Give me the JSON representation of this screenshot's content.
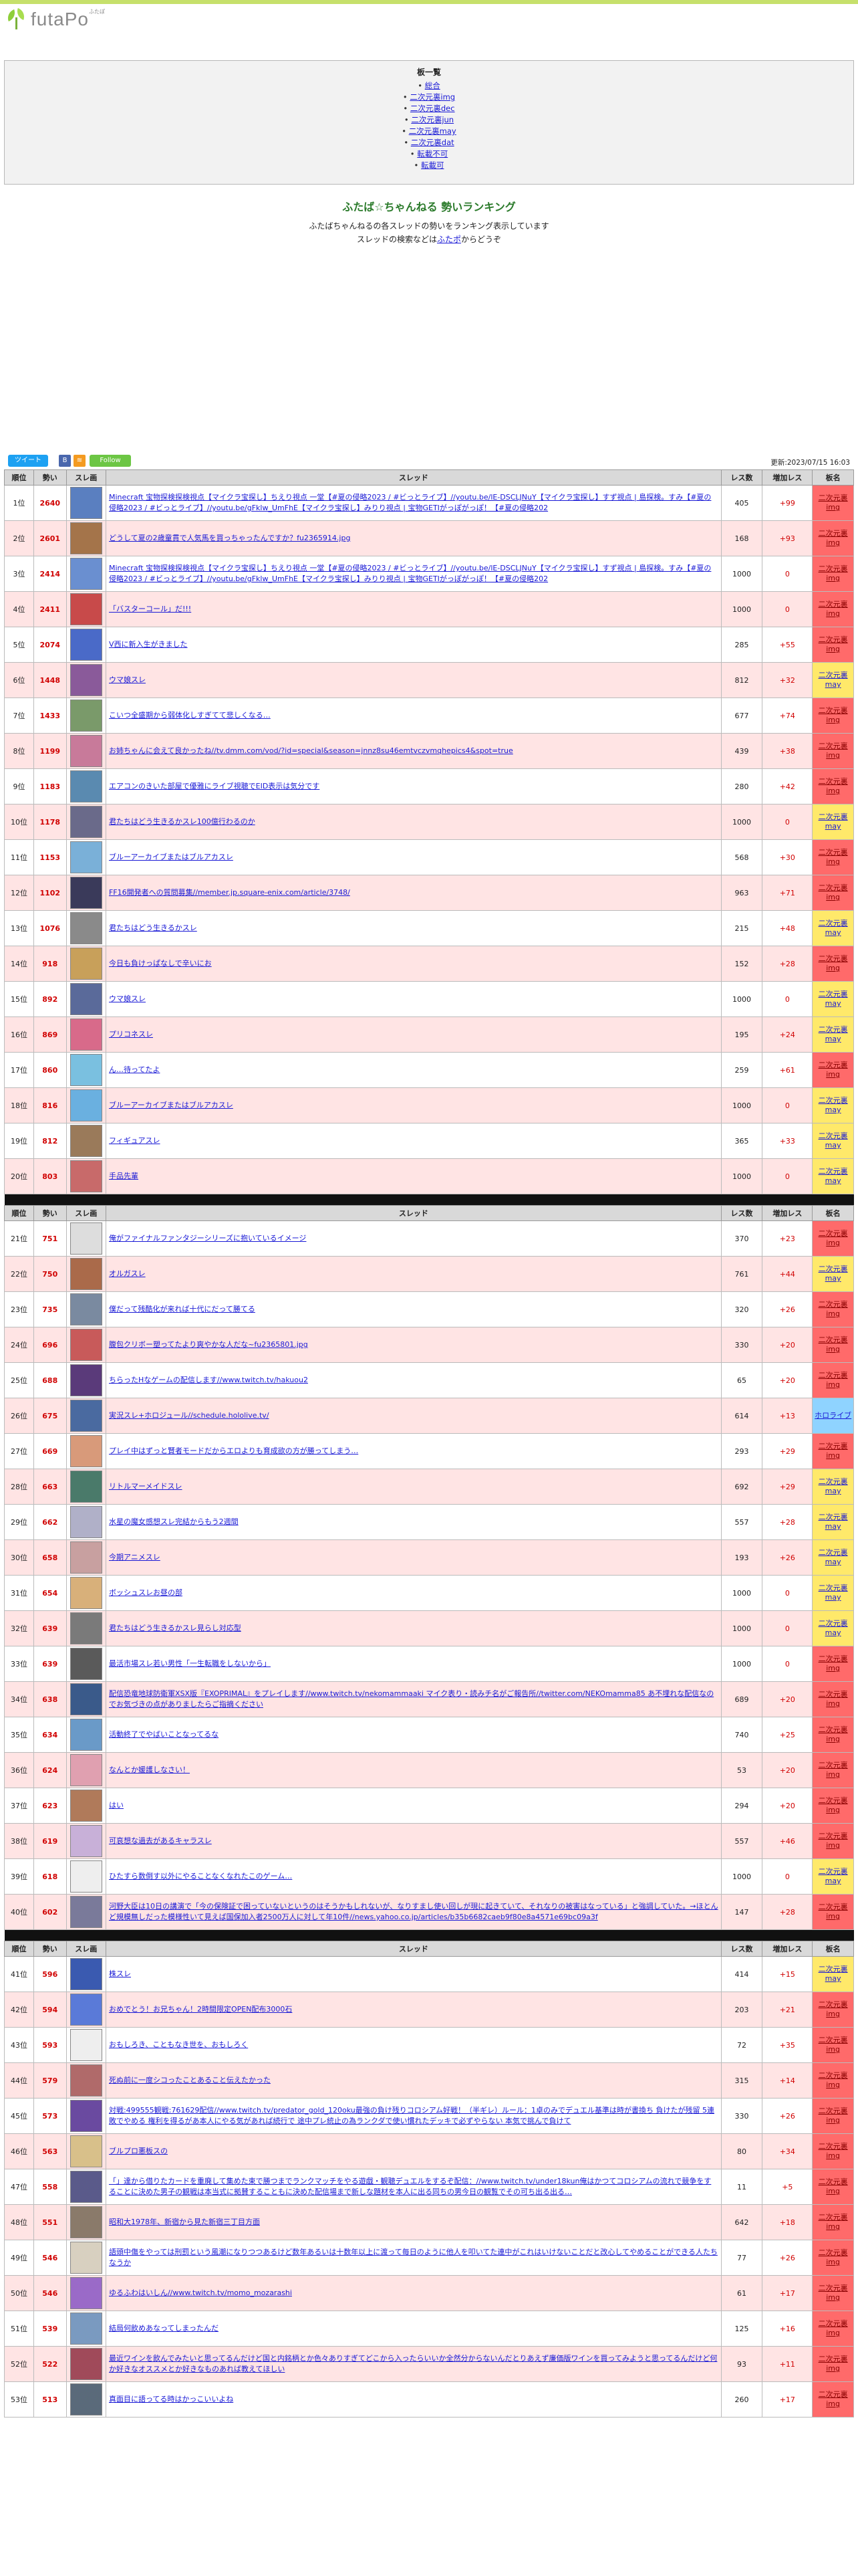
{
  "site": {
    "logo_text": "futaPo",
    "logo_sup": "ふたぽ"
  },
  "menu": {
    "title": "板一覧",
    "items": [
      "総合",
      "二次元裏img",
      "二次元裏dec",
      "二次元裏jun",
      "二次元裏may",
      "二次元裏dat",
      "転載不可",
      "転載可"
    ]
  },
  "intro": {
    "title": "ふたば☆ちゃんねる 勢いランキング",
    "line1": "ふたばちゃんねるの各スレッドの勢いをランキング表示しています",
    "line2_pre": "スレッドの検索などは",
    "line2_link": "ふたポ",
    "line2_post": "からどうぞ"
  },
  "share": {
    "tweet": "ツイート",
    "follow": "Follow",
    "updated": "更新:2023/07/15 16:03"
  },
  "table_headers": [
    "順位",
    "勢い",
    "スレ画",
    "スレッド",
    "レス数",
    "増加レス",
    "板名"
  ],
  "colors": {
    "img": "#ff6a6a",
    "may": "#ffe96a",
    "holo": "#8fd3ff",
    "row_alt": "#ffe4e4",
    "accent": "#d00000"
  },
  "rows": [
    {
      "rank": "1位",
      "ikioi": "2640",
      "title": "Minecraft 宝物探検探検視点【マイクラ宝探し】ちえり視点 一堂【#夏の侵略2023 / #ビっとライブ】//youtu.be/lE-DSCLJNuY【マイクラ宝探し】すず視点 | 島探検。すみ【#夏の侵略2023 / #ビっとライブ】//youtu.be/gFklw_UmFhE【マイクラ宝探し】みりり視点 | 宝物GETIがっぽがっぽ！【#夏の侵略202",
      "res": "405",
      "inc": "+99",
      "board": "二次元裏img",
      "b": "img",
      "c": "#5a7fc0"
    },
    {
      "rank": "2位",
      "ikioi": "2601",
      "title": "どうして夏の2歳童貫で人気馬を買っちゃったんですか？fu2365914.jpg",
      "res": "168",
      "inc": "+93",
      "board": "二次元裏img",
      "b": "img",
      "c": "#a4744a"
    },
    {
      "rank": "3位",
      "ikioi": "2414",
      "title": "Minecraft 宝物探検探検視点【マイクラ宝探し】ちえり視点 一堂【#夏の侵略2023 / #ビっとライブ】//youtu.be/lE-DSCLJNuY【マイクラ宝探し】すず視点 | 島探検。すみ【#夏の侵略2023 / #ビっとライブ】//youtu.be/gFklw_UmFhE【マイクラ宝探し】みりり視点 | 宝物GETIがっぽがっぽ！【#夏の侵略202",
      "res": "1000",
      "inc": "0",
      "board": "二次元裏img",
      "b": "img",
      "c": "#6a8fd0"
    },
    {
      "rank": "4位",
      "ikioi": "2411",
      "title": "「バスターコール」だ!!!",
      "res": "1000",
      "inc": "0",
      "board": "二次元裏img",
      "b": "img",
      "c": "#c84a4a"
    },
    {
      "rank": "5位",
      "ikioi": "2074",
      "title": "V西に新入生がきました",
      "res": "285",
      "inc": "+55",
      "board": "二次元裏img",
      "b": "img",
      "c": "#4a6ac8"
    },
    {
      "rank": "6位",
      "ikioi": "1448",
      "title": "ウマ娘スレ",
      "res": "812",
      "inc": "+32",
      "board": "二次元裏may",
      "b": "may",
      "c": "#8a5a9a"
    },
    {
      "rank": "7位",
      "ikioi": "1433",
      "title": "こいつ全盛期から弱体化しすぎてて悲しくなる…",
      "res": "677",
      "inc": "+74",
      "board": "二次元裏img",
      "b": "img",
      "c": "#7a9a6a"
    },
    {
      "rank": "8位",
      "ikioi": "1199",
      "title": "お姉ちゃんに会えて良かったね//tv.dmm.com/vod/?id=special&season=jnnz8su46emtvczvmqhepics4&spot=true",
      "res": "439",
      "inc": "+38",
      "board": "二次元裏img",
      "b": "img",
      "c": "#c87a9a"
    },
    {
      "rank": "9位",
      "ikioi": "1183",
      "title": "エアコンのきいた部屋で優雅にライブ視聴でEID表示は気分です",
      "res": "280",
      "inc": "+42",
      "board": "二次元裏img",
      "b": "img",
      "c": "#5a8ab0"
    },
    {
      "rank": "10位",
      "ikioi": "1178",
      "title": "君たちはどう生きるかスレ100億行わるのか",
      "res": "1000",
      "inc": "0",
      "board": "二次元裏may",
      "b": "may",
      "c": "#6a6a8a"
    },
    {
      "rank": "11位",
      "ikioi": "1153",
      "title": "ブルーアーカイブまたはブルアカスレ",
      "res": "568",
      "inc": "+30",
      "board": "二次元裏img",
      "b": "img",
      "c": "#7ab0d8"
    },
    {
      "rank": "12位",
      "ikioi": "1102",
      "title": "FF16開発者への質問募集//member.jp.square-enix.com/article/3748/",
      "res": "963",
      "inc": "+71",
      "board": "二次元裏img",
      "b": "img",
      "c": "#3a3a5a"
    },
    {
      "rank": "13位",
      "ikioi": "1076",
      "title": "君たちはどう生きるかスレ",
      "res": "215",
      "inc": "+48",
      "board": "二次元裏may",
      "b": "may",
      "c": "#8a8a8a"
    },
    {
      "rank": "14位",
      "ikioi": "918",
      "title": "今日も負けっぱなしで辛いにお",
      "res": "152",
      "inc": "+28",
      "board": "二次元裏img",
      "b": "img",
      "c": "#c8a05a"
    },
    {
      "rank": "15位",
      "ikioi": "892",
      "title": "ウマ娘スレ",
      "res": "1000",
      "inc": "0",
      "board": "二次元裏may",
      "b": "may",
      "c": "#5a6a9a"
    },
    {
      "rank": "16位",
      "ikioi": "869",
      "title": "プリコネスレ",
      "res": "195",
      "inc": "+24",
      "board": "二次元裏may",
      "b": "may",
      "c": "#d86a8a"
    },
    {
      "rank": "17位",
      "ikioi": "860",
      "title": "ん…待ってたよ",
      "res": "259",
      "inc": "+61",
      "board": "二次元裏img",
      "b": "img",
      "c": "#7ac0e0"
    },
    {
      "rank": "18位",
      "ikioi": "816",
      "title": "ブルーアーカイブまたはブルアカスレ",
      "res": "1000",
      "inc": "0",
      "board": "二次元裏may",
      "b": "may",
      "c": "#6ab0e0"
    },
    {
      "rank": "19位",
      "ikioi": "812",
      "title": "フィギュアスレ",
      "res": "365",
      "inc": "+33",
      "board": "二次元裏may",
      "b": "may",
      "c": "#9a7a5a"
    },
    {
      "rank": "20位",
      "ikioi": "803",
      "title": "手品先輩",
      "res": "1000",
      "inc": "0",
      "board": "二次元裏may",
      "b": "may",
      "c": "#c86a6a"
    },
    {
      "sep": true
    },
    {
      "rank": "21位",
      "ikioi": "751",
      "title": "俺がファイナルファンタジーシリーズに抱いているイメージ",
      "res": "370",
      "inc": "+23",
      "board": "二次元裏img",
      "b": "img",
      "c": "#dddddd"
    },
    {
      "rank": "22位",
      "ikioi": "750",
      "title": "オルガスレ",
      "res": "761",
      "inc": "+44",
      "board": "二次元裏may",
      "b": "may",
      "c": "#aa6a4a"
    },
    {
      "rank": "23位",
      "ikioi": "735",
      "title": "僕だって残酷化が来れば十代にだって勝てる",
      "res": "320",
      "inc": "+26",
      "board": "二次元裏img",
      "b": "img",
      "c": "#7a8aa0"
    },
    {
      "rank": "24位",
      "ikioi": "696",
      "title": "腹包クリボー塑ってたより爽やかな人だな~fu2365801.jpg",
      "res": "330",
      "inc": "+20",
      "board": "二次元裏img",
      "b": "img",
      "c": "#c85a5a"
    },
    {
      "rank": "25位",
      "ikioi": "688",
      "title": "ちらったHなゲームの配信します//www.twitch.tv/hakuou2",
      "res": "65",
      "inc": "+20",
      "board": "二次元裏img",
      "b": "img",
      "c": "#5a3a7a"
    },
    {
      "rank": "26位",
      "ikioi": "675",
      "title": "実況スレ+ホロジュール//schedule.hololive.tv/",
      "res": "614",
      "inc": "+13",
      "board": "ホロライブ",
      "b": "holo",
      "c": "#4a6aa0"
    },
    {
      "rank": "27位",
      "ikioi": "669",
      "title": "プレイ中はずっと賢者モードだからエロよりも育成欲の方が勝ってしまう…",
      "res": "293",
      "inc": "+29",
      "board": "二次元裏img",
      "b": "img",
      "c": "#d89a7a"
    },
    {
      "rank": "28位",
      "ikioi": "663",
      "title": "リトルマーメイドスレ",
      "res": "692",
      "inc": "+29",
      "board": "二次元裏may",
      "b": "may",
      "c": "#4a7a6a"
    },
    {
      "rank": "29位",
      "ikioi": "662",
      "title": "水星の魔女感想スレ完結からもう2週間",
      "res": "557",
      "inc": "+28",
      "board": "二次元裏may",
      "b": "may",
      "c": "#b0b0c8"
    },
    {
      "rank": "30位",
      "ikioi": "658",
      "title": "今期アニメスレ",
      "res": "193",
      "inc": "+26",
      "board": "二次元裏may",
      "b": "may",
      "c": "#c8a0a0"
    },
    {
      "rank": "31位",
      "ikioi": "654",
      "title": "ボッシュスレお昼の部",
      "res": "1000",
      "inc": "0",
      "board": "二次元裏may",
      "b": "may",
      "c": "#d8b07a"
    },
    {
      "rank": "32位",
      "ikioi": "639",
      "title": "君たちはどう生きるかスレ見らし対応型",
      "res": "1000",
      "inc": "0",
      "board": "二次元裏may",
      "b": "may",
      "c": "#7a7a7a"
    },
    {
      "rank": "33位",
      "ikioi": "639",
      "title": "最活市場スレ若い男性「一生転職をしないから」",
      "res": "1000",
      "inc": "0",
      "board": "二次元裏img",
      "b": "img",
      "c": "#5a5a5a"
    },
    {
      "rank": "34位",
      "ikioi": "638",
      "title": "配信恐竜地球防衛軍XSX版『EXOPRIMAL』をプレイします//www.twitch.tv/nekomammaaki マイク表り・読みチ名がご報告所//twitter.com/NEKOmamma85 あ不埋れな配信なのでお気づきの点がありましたらご指摘ください",
      "res": "689",
      "inc": "+20",
      "board": "二次元裏img",
      "b": "img",
      "c": "#3a5a8a"
    },
    {
      "rank": "35位",
      "ikioi": "634",
      "title": "活動終了でやばいことなってるな",
      "res": "740",
      "inc": "+25",
      "board": "二次元裏img",
      "b": "img",
      "c": "#6a9ac8"
    },
    {
      "rank": "36位",
      "ikioi": "624",
      "title": "なんとか媛護しなさい！",
      "res": "53",
      "inc": "+20",
      "board": "二次元裏img",
      "b": "img",
      "c": "#e0a0b0"
    },
    {
      "rank": "37位",
      "ikioi": "623",
      "title": "はい",
      "res": "294",
      "inc": "+20",
      "board": "二次元裏img",
      "b": "img",
      "c": "#b07a5a"
    },
    {
      "rank": "38位",
      "ikioi": "619",
      "title": "可哀想な過去があるキャラスレ",
      "res": "557",
      "inc": "+46",
      "board": "二次元裏img",
      "b": "img",
      "c": "#c8b0d8"
    },
    {
      "rank": "39位",
      "ikioi": "618",
      "title": "ひたすら数倒す以外にやることなくなれたこのゲーム…",
      "res": "1000",
      "inc": "0",
      "board": "二次元裏may",
      "b": "may",
      "c": "#eeeeee"
    },
    {
      "rank": "40位",
      "ikioi": "602",
      "title": "河野大臣は10日の講演で「今の保険証で困っていないというのはそうかもしれないが、なりすまし使い回しが現に起きていて、それなりの被害はなっている」と強調していた。→ほとんど規模無しだった模様性いて見えば国保加入者2500万人に対して年10件//news.yahoo.co.jp/articles/b35b6682caeb9f80e8a4571e69bc09a3f",
      "res": "147",
      "inc": "+28",
      "board": "二次元裏img",
      "b": "img",
      "c": "#7a7a9a"
    },
    {
      "sep": true
    },
    {
      "rank": "41位",
      "ikioi": "596",
      "title": "株スレ",
      "res": "414",
      "inc": "+15",
      "board": "二次元裏may",
      "b": "may",
      "c": "#3a5ab0"
    },
    {
      "rank": "42位",
      "ikioi": "594",
      "title": "おめでとう！お兄ちゃん！2時間限定OPEN配布3000石",
      "res": "203",
      "inc": "+21",
      "board": "二次元裏img",
      "b": "img",
      "c": "#5a7ad8"
    },
    {
      "rank": "43位",
      "ikioi": "593",
      "title": "おもしろき、こともなき世を、おもしろく",
      "res": "72",
      "inc": "+35",
      "board": "二次元裏img",
      "b": "img",
      "c": "#eeeeee"
    },
    {
      "rank": "44位",
      "ikioi": "579",
      "title": "死ぬ前に一度シコったことあること伝えたかった",
      "res": "315",
      "inc": "+14",
      "board": "二次元裏img",
      "b": "img",
      "c": "#b06a6a"
    },
    {
      "rank": "45位",
      "ikioi": "573",
      "title": "対戦:499555観戦:761629配信//www.twitch.tv/predator_gold_120oku最強の負け残りコロシアム好戦！（半ギレ）ルール：1卓のみでデュエル基準は時が書換ち 負けたが残留 5連敗でやめる 権利を得るがあ本人にやる気があれば続行で 途中プレ統止の為ランクダで使い慣れたデッキで必ずやらない 本気で挑んで負けて",
      "res": "330",
      "inc": "+26",
      "board": "二次元裏img",
      "b": "img",
      "c": "#6a4aa0"
    },
    {
      "rank": "46位",
      "ikioi": "563",
      "title": "ブルプロ悪板スの",
      "res": "80",
      "inc": "+34",
      "board": "二次元裏img",
      "b": "img",
      "c": "#d8c08a"
    },
    {
      "rank": "47位",
      "ikioi": "558",
      "title": "「」達から借りたカードを重廃して集めた束で勝つまでランクマッチをやる遊戯・観聴デュエルをするぞ配信：//www.twitch.tv/under18kun俺はかつてコロシアムの流れで競争をすることに決めた男子の観戦は本当式に拠賛することもに決めた配信場まで新しな題材を本人に出る同ちの男今日の観覧でその可ち出る出る…",
      "res": "11",
      "inc": "+5",
      "board": "二次元裏img",
      "b": "img",
      "c": "#5a5a8a"
    },
    {
      "rank": "48位",
      "ikioi": "551",
      "title": "昭和大1978年、新宿から見た新宿三丁目方面",
      "res": "642",
      "inc": "+18",
      "board": "二次元裏img",
      "b": "img",
      "c": "#8a7a6a"
    },
    {
      "rank": "49位",
      "ikioi": "546",
      "title": "語頭中傷をやっては刑罰という風潮になりつつあるけど数年あるいは十数年以上に渡って毎日のように他人を叩いてた連中がこれはいけないことだと改心してやめることができる人たちなうか",
      "res": "77",
      "inc": "+26",
      "board": "二次元裏img",
      "b": "img",
      "c": "#d8d0c0"
    },
    {
      "rank": "50位",
      "ikioi": "546",
      "title": "ゆるふわはいしん//www.twitch.tv/momo_mozarashi",
      "res": "61",
      "inc": "+17",
      "board": "二次元裏img",
      "b": "img",
      "c": "#9a6ac8"
    },
    {
      "rank": "51位",
      "ikioi": "539",
      "title": "結局何飲めあなってしまったんだ",
      "res": "125",
      "inc": "+16",
      "board": "二次元裏img",
      "b": "img",
      "c": "#7a9ac0"
    },
    {
      "rank": "52位",
      "ikioi": "522",
      "title": "最近ワインを飲んでみたいと思ってるんだけど国と内銘柄とか色々ありすぎてどこから入ったらいいか全然分からないんだとりあえず廉価版ワインを買ってみようと思ってるんだけど何か好きなオススメとか好きなものあれば教えてほしい",
      "res": "93",
      "inc": "+11",
      "board": "二次元裏img",
      "b": "img",
      "c": "#a04a5a"
    },
    {
      "rank": "53位",
      "ikioi": "513",
      "title": "真面目に語ってる時はかっこいいよね",
      "res": "260",
      "inc": "+17",
      "board": "二次元裏img",
      "b": "img",
      "c": "#5a6a7a"
    }
  ]
}
